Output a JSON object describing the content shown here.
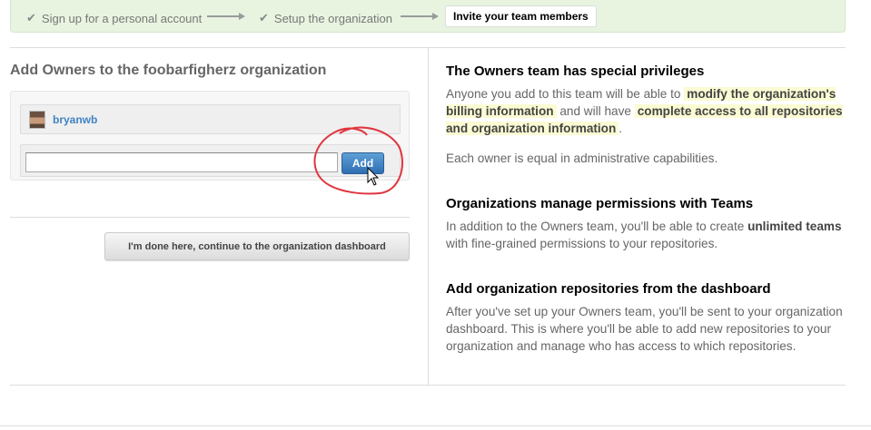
{
  "steps": {
    "step1": "Sign up for a personal account",
    "step2": "Setup the organization",
    "step3": "Invite your team members"
  },
  "left": {
    "title": "Add Owners to the foobarfigherz organization",
    "member_name": "bryanwb",
    "input_value": "",
    "add_label": "Add",
    "done_label": "I'm done here, continue to the organization dashboard"
  },
  "right": {
    "h1": "The Owners team has special privileges",
    "p1_a": "Anyone you add to this team will be able to",
    "p1_hl1": "modify the organization's billing information",
    "p1_b": "and will have",
    "p1_hl2": "complete access to all repositories and organization information",
    "p1_c": ".",
    "p2": "Each owner is equal in administrative capabilities.",
    "h2": "Organizations manage permissions with Teams",
    "p3_a": "In addition to the Owners team, you'll be able to create",
    "p3_b": "unlimited teams",
    "p3_c": "with fine-grained permissions to your repositories.",
    "h3": "Add organization repositories from the dashboard",
    "p4": "After you've set up your Owners team, you'll be sent to your organization dashboard. This is where you'll be able to add new repositories to your organization and manage who has access to which repositories."
  },
  "colors": {
    "steps_bg": "#e8f4e0",
    "link": "#4183c4",
    "add_button": "#3a7dc0",
    "highlight": "#fbfbd4",
    "annotation": "#e0353f"
  },
  "icons": [
    "check-icon",
    "arrow-right-icon",
    "mouse-cursor-icon"
  ]
}
